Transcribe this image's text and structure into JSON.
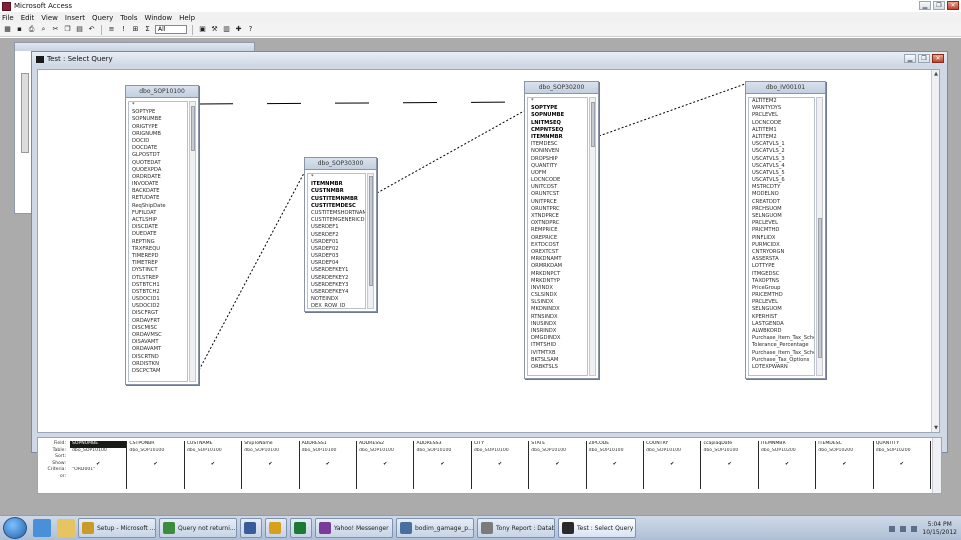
{
  "app": {
    "title": "Microsoft Access",
    "minimize": "▁",
    "restore": "❐",
    "close": "✕"
  },
  "menu": [
    "File",
    "Edit",
    "View",
    "Insert",
    "Query",
    "Tools",
    "Window",
    "Help"
  ],
  "toolbar": {
    "icons": [
      "view-icon",
      "save-icon",
      "print-icon",
      "print-preview-icon",
      "cut-icon",
      "copy-icon",
      "paste-icon",
      "undo-icon",
      "query-type-icon",
      "run-icon",
      "show-table-icon",
      "totals-icon"
    ],
    "top_values": "All"
  },
  "query_window": {
    "title": "Test : Select Query",
    "minimize": "▁",
    "restore": "❐",
    "close": "✕"
  },
  "tables": [
    {
      "name": "dbo_SOP10100",
      "fields": [
        "*",
        "SOPTYPE",
        "SOPNUMBE",
        "ORIGTYPE",
        "ORIGNUMB",
        "DOCID",
        "DOCDATE",
        "GLPOSTDT",
        "QUOTEDAT",
        "QUOEXPDA",
        "ORDRDATE",
        "INVODATE",
        "BACKDATE",
        "RETUDATE",
        "ReqShipDate",
        "FUFILDAT",
        "ACTLSHIP",
        "DISCDATE",
        "DUEDATE",
        "REPTING",
        "TRXFREQU",
        "TIMEREPD",
        "TIMETREP",
        "DYSTINCT",
        "DTLSTREP",
        "DSTBTCH1",
        "DSTBTCH2",
        "USDOCID1",
        "USDOCID2",
        "DISCFRGT",
        "ORDAVFRT",
        "DISCMISC",
        "ORDAVMSC",
        "DISAVAMT",
        "ORDAVAMT",
        "DISCRTND",
        "ORDISTKN",
        "DSCPCTAM"
      ]
    },
    {
      "name": "dbo_SOP30300",
      "fields": [
        "*",
        "ITEMNMBR",
        "CUSTNMBR",
        "CUSTITEMNMBR",
        "CUSTITEMDESC",
        "CUSTITEMSHORTNAME",
        "CUSTITEMGENERICDESC",
        "USERDEF1",
        "USERDEF2",
        "USRDEF01",
        "USRDEF02",
        "USRDEF03",
        "USRDEF04",
        "USERDEFKEY1",
        "USERDEFKEY2",
        "USERDEFKEY3",
        "USERDEFKEY4",
        "NOTEINDX",
        "DEX_ROW_ID"
      ]
    },
    {
      "name": "dbo_SOP30200",
      "fields": [
        "*",
        "SOPTYPE",
        "SOPNUMBE",
        "LNITMSEQ",
        "CMPNTSEQ",
        "ITEMNMBR",
        "ITEMDESC",
        "NONINVEN",
        "DROPSHIP",
        "QUANTITY",
        "UOFM",
        "LOCNCODE",
        "UNITCOST",
        "ORUNTCST",
        "UNITPRCE",
        "ORUNTPRC",
        "XTNDPRCE",
        "OXTNDPRC",
        "REMPRICE",
        "OREPRICE",
        "EXTDCOST",
        "OREXTCST",
        "MRKDNAMT",
        "ORMRKDAM",
        "MRKDNPCT",
        "MRKDNTYP",
        "INVINDX",
        "CSLSINDX",
        "SLSINDX",
        "MKDNINDX",
        "RTNSINDX",
        "INUSINDX",
        "INSRINDX",
        "DMGDINDX",
        "ITMTSHID",
        "IVITMTXB",
        "BKTSLSAM",
        "ORBKTSLS"
      ]
    },
    {
      "name": "dbo_IV00101",
      "fields": [
        "ALTITEM2",
        "WRNTYDYS",
        "PRCLEVEL",
        "LOCNCODE",
        "ALTITEM1",
        "ALTITEM2",
        "USCATVLS_1",
        "USCATVLS_2",
        "USCATVLS_3",
        "USCATVLS_4",
        "USCATVLS_5",
        "USCATVLS_6",
        "MSTRCDTY",
        "MODELNO",
        "CREATDDT",
        "PRCHSUOM",
        "SELNGUOM",
        "PRCLEVEL",
        "PRICMTHD",
        "PINFLIDX",
        "PURMCIDX",
        "CNTRYORGN",
        "ASSERSTA",
        "LOTTYPE",
        "ITMGEDSC",
        "TAXOPTNS",
        "PriceGroup",
        "PRICEMTHD",
        "PRCLEVEL",
        "SELNGUOM",
        "KPERHIST",
        "LASTGENDA",
        "ALWBKORD",
        "Purchase_Item_Tax_Schedule",
        "Tolerance_Percentage",
        "Purchase_Item_Tax_Sched",
        "Purchase_Tax_Options",
        "LOTEXPWARN"
      ]
    }
  ],
  "grid": {
    "row_labels": [
      "Field:",
      "Table:",
      "Sort:",
      "Show:",
      "Criteria:",
      "or:"
    ],
    "columns": [
      {
        "field": "SOPNUMBE",
        "table": "dbo_SOP10100",
        "show": true,
        "criteria": "\"ORD001\"",
        "selected": true
      },
      {
        "field": "CSTPONBR",
        "table": "dbo_SOP10100",
        "show": true,
        "criteria": ""
      },
      {
        "field": "CUSTNAME",
        "table": "dbo_SOP10100",
        "show": true,
        "criteria": ""
      },
      {
        "field": "ShipToName",
        "table": "dbo_SOP10100",
        "show": true,
        "criteria": ""
      },
      {
        "field": "ADDRESS1",
        "table": "dbo_SOP10100",
        "show": true,
        "criteria": ""
      },
      {
        "field": "ADDRESS2",
        "table": "dbo_SOP10100",
        "show": true,
        "criteria": ""
      },
      {
        "field": "ADDRESS3",
        "table": "dbo_SOP10100",
        "show": true,
        "criteria": ""
      },
      {
        "field": "CITY",
        "table": "dbo_SOP10100",
        "show": true,
        "criteria": ""
      },
      {
        "field": "STATE",
        "table": "dbo_SOP10100",
        "show": true,
        "criteria": ""
      },
      {
        "field": "ZIPCODE",
        "table": "dbo_SOP10100",
        "show": true,
        "criteria": ""
      },
      {
        "field": "COUNTRY",
        "table": "dbo_SOP10100",
        "show": true,
        "criteria": ""
      },
      {
        "field": "ccaplaqDate",
        "table": "dbo_SOP10100",
        "show": true,
        "criteria": ""
      },
      {
        "field": "ITEMNMBR",
        "table": "dbo_SOP10200",
        "show": true,
        "criteria": ""
      },
      {
        "field": "ITEMDESC",
        "table": "dbo_SOP10200",
        "show": true,
        "criteria": ""
      },
      {
        "field": "QUANTITY",
        "table": "dbo_SOP10200",
        "show": true,
        "criteria": ""
      }
    ]
  },
  "taskbar": {
    "tasks": [
      {
        "label": "Setup - Microsoft ...",
        "icon": "access-icon",
        "color": "#c99b2a"
      },
      {
        "label": "Query not returni...",
        "icon": "chrome-icon",
        "color": "#3b8c3e"
      },
      {
        "label": "",
        "icon": "app-icon",
        "color": "#3c5b9a"
      },
      {
        "label": "",
        "icon": "app-icon",
        "color": "#d6a21e"
      },
      {
        "label": "",
        "icon": "excel-icon",
        "color": "#1d7a35"
      },
      {
        "label": "Yahoo! Messenger",
        "icon": "yahoo-icon",
        "color": "#7a3a99"
      },
      {
        "label": "bodim_gamage_p...",
        "icon": "app-icon",
        "color": "#4a6f9e"
      },
      {
        "label": "Tony Report : Datab...",
        "icon": "report-icon",
        "color": "#7b7b7b"
      },
      {
        "label": "Test : Select Query",
        "icon": "query-icon",
        "color": "#2a2a2a",
        "active": true
      }
    ],
    "clock_time": "5:04 PM",
    "clock_date": "10/15/2012"
  }
}
